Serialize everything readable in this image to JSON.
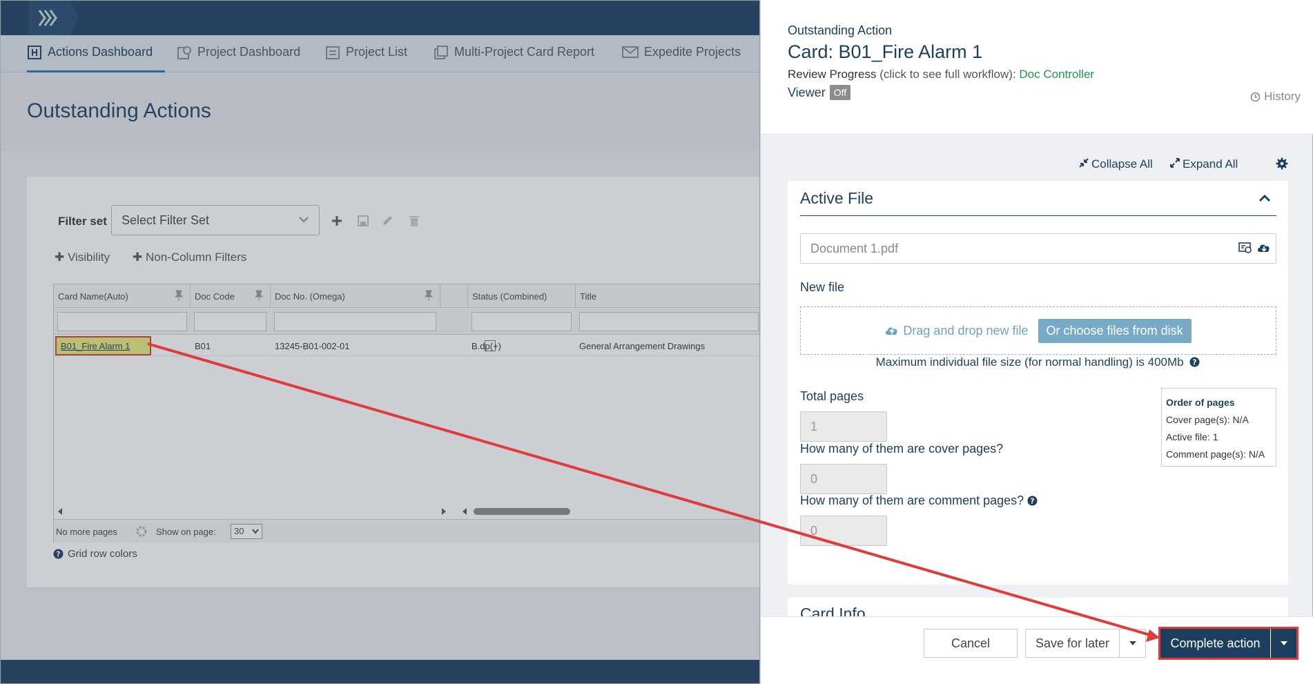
{
  "nav": {
    "tabs": [
      {
        "label": "Actions Dashboard"
      },
      {
        "label": "Project Dashboard"
      },
      {
        "label": "Project List"
      },
      {
        "label": "Multi-Project Card Report"
      },
      {
        "label": "Expedite Projects"
      }
    ]
  },
  "page": {
    "title": "Outstanding Actions"
  },
  "filters": {
    "label": "Filter set",
    "select_value": "Select Filter Set",
    "visibility": "Visibility",
    "non_column": "Non-Column Filters"
  },
  "grid": {
    "columns": [
      "Card Name(Auto)",
      "Doc Code",
      "Doc No. (Omega)",
      "",
      "Status (Combined)",
      "Title"
    ],
    "row": {
      "card_name": "B01_Fire Alarm 1",
      "doc_code": "B01",
      "doc_no": "13245-B01-002-01",
      "status": "B.dp(+)",
      "title": "General Arrangement Drawings"
    },
    "pager": {
      "no_more": "No more pages",
      "show_on_page": "Show on page:",
      "page_size": "30"
    },
    "row_colors": "Grid row colors"
  },
  "drawer": {
    "kicker": "Outstanding Action",
    "title": "Card: B01_Fire Alarm 1",
    "review_label": "Review Progress",
    "review_hint": "(click to see full workflow):",
    "review_value": "Doc Controller",
    "viewer_label": "Viewer",
    "viewer_state": "Off",
    "history": "History",
    "collapse_all": "Collapse All",
    "expand_all": "Expand All",
    "active_file": {
      "title": "Active File",
      "file_name": "Document 1.pdf",
      "new_file_label": "New file",
      "drag_text": "Drag and drop new file",
      "choose_btn": "Or choose files from disk",
      "max_size": "Maximum individual file size (for normal handling) is 400Mb",
      "total_pages_label": "Total pages",
      "total_pages": "1",
      "cover_label": "How many of them are cover pages?",
      "cover_value": "0",
      "comment_label": "How many of them are comment pages?",
      "comment_value": "0",
      "order": {
        "title": "Order of pages",
        "cover": "Cover page(s): N/A",
        "active": "Active file: 1",
        "comment": "Comment page(s): N/A"
      }
    },
    "card_info_title": "Card Info",
    "footer": {
      "cancel": "Cancel",
      "save_later": "Save for later",
      "complete": "Complete action"
    }
  },
  "colors": {
    "navy": "#1c3e5f",
    "green": "#1a9b46",
    "highlight": "#e03a3a",
    "light_blue": "#76aac6"
  }
}
